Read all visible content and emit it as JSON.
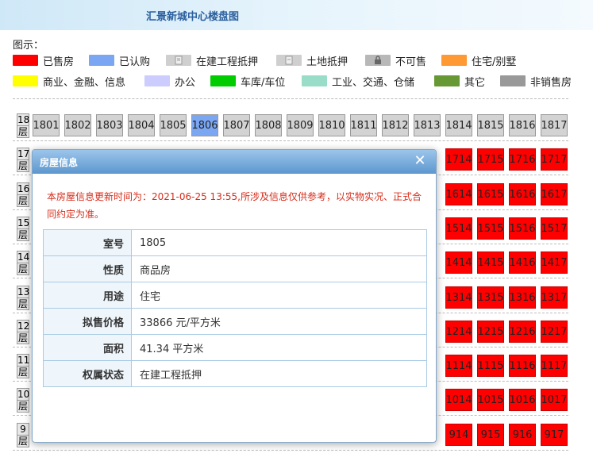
{
  "header": {
    "title": "汇景新城中心楼盘图"
  },
  "legend": {
    "label": "图示：",
    "items": [
      {
        "label": "已售房",
        "color": "#ff0000"
      },
      {
        "label": "已认购",
        "color": "#7ba7f2"
      },
      {
        "label": "在建工程抵押",
        "icon": "mortgage-doc-icon"
      },
      {
        "label": "土地抵押",
        "icon": "land-doc-icon"
      },
      {
        "label": "不可售",
        "icon": "lock-icon"
      },
      {
        "label": "住宅/别墅",
        "color": "#ff9933"
      },
      {
        "label": "商业、金融、信息",
        "color": "#ffff00"
      },
      {
        "label": "办公",
        "color": "#ccccff"
      },
      {
        "label": "车库/车位",
        "color": "#00cc00"
      },
      {
        "label": "工业、交通、仓储",
        "color": "#99ddc8"
      },
      {
        "label": "其它",
        "color": "#669933"
      },
      {
        "label": "非销售房",
        "color": "#999999"
      }
    ]
  },
  "floors": [
    {
      "num": "18",
      "suffix": "层",
      "units": [
        {
          "no": "1801",
          "status": "gray"
        },
        {
          "no": "1802",
          "status": "gray"
        },
        {
          "no": "1803",
          "status": "gray"
        },
        {
          "no": "1804",
          "status": "gray"
        },
        {
          "no": "1805",
          "status": "gray"
        },
        {
          "no": "1806",
          "status": "blue"
        },
        {
          "no": "1807",
          "status": "gray"
        },
        {
          "no": "1808",
          "status": "gray"
        },
        {
          "no": "1809",
          "status": "gray"
        },
        {
          "no": "1810",
          "status": "gray"
        },
        {
          "no": "1811",
          "status": "gray"
        },
        {
          "no": "1812",
          "status": "gray"
        },
        {
          "no": "1813",
          "status": "gray"
        },
        {
          "no": "1814",
          "status": "gray"
        },
        {
          "no": "1815",
          "status": "gray"
        },
        {
          "no": "1816",
          "status": "gray"
        },
        {
          "no": "1817",
          "status": "gray"
        }
      ]
    },
    {
      "num": "17",
      "suffix": "层",
      "units": [
        {
          "no": "1714"
        },
        {
          "no": "1715"
        },
        {
          "no": "1716"
        },
        {
          "no": "1717"
        }
      ]
    },
    {
      "num": "16",
      "suffix": "层",
      "units": [
        {
          "no": "1614"
        },
        {
          "no": "1615"
        },
        {
          "no": "1616"
        },
        {
          "no": "1617"
        }
      ]
    },
    {
      "num": "15",
      "suffix": "层",
      "units": [
        {
          "no": "1514"
        },
        {
          "no": "1515"
        },
        {
          "no": "1516"
        },
        {
          "no": "1517"
        }
      ]
    },
    {
      "num": "14",
      "suffix": "层",
      "units": [
        {
          "no": "1414"
        },
        {
          "no": "1415"
        },
        {
          "no": "1416"
        },
        {
          "no": "1417"
        }
      ]
    },
    {
      "num": "13",
      "suffix": "层",
      "units": [
        {
          "no": "1314"
        },
        {
          "no": "1315"
        },
        {
          "no": "1316"
        },
        {
          "no": "1317"
        }
      ]
    },
    {
      "num": "12",
      "suffix": "层",
      "units": [
        {
          "no": "1214"
        },
        {
          "no": "1215"
        },
        {
          "no": "1216"
        },
        {
          "no": "1217"
        }
      ]
    },
    {
      "num": "11",
      "suffix": "层",
      "units": [
        {
          "no": "1114"
        },
        {
          "no": "1115"
        },
        {
          "no": "1116"
        },
        {
          "no": "1117"
        }
      ]
    },
    {
      "num": "10",
      "suffix": "层",
      "units": [
        {
          "no": "1014"
        },
        {
          "no": "1015"
        },
        {
          "no": "1016"
        },
        {
          "no": "1017"
        }
      ]
    },
    {
      "num": "9",
      "suffix": "层",
      "units": [
        {
          "no": "914"
        },
        {
          "no": "915"
        },
        {
          "no": "916"
        },
        {
          "no": "917"
        }
      ]
    }
  ],
  "modal": {
    "title": "房屋信息",
    "notice": "本房屋信息更新时间为：2021-06-25 13:55,所涉及信息仅供参考，以实物实况、正式合同约定为准。",
    "rows": [
      {
        "key": "室号",
        "value": "1805"
      },
      {
        "key": "性质",
        "value": "商品房"
      },
      {
        "key": "用途",
        "value": "住宅"
      },
      {
        "key": "拟售价格",
        "value": "33866 元/平方米"
      },
      {
        "key": "面积",
        "value": "41.34 平方米"
      },
      {
        "key": "权属状态",
        "value": "在建工程抵押"
      }
    ]
  }
}
